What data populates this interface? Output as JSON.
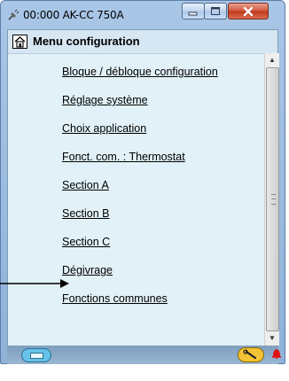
{
  "window": {
    "title": "00:000 AK-CC 750A",
    "icon": "plug-icon",
    "controls": [
      "minimize-icon",
      "maximize-icon",
      "close-icon"
    ]
  },
  "menu": {
    "title": "Menu configuration",
    "home_icon": "home-icon",
    "items": [
      "Bloque / débloque configuration",
      "Réglage système",
      "Choix application",
      "Fonct. com. : Thermostat",
      "Section A",
      "Section B",
      "Section C",
      "Dégivrage",
      "Fonctions communes"
    ]
  },
  "scrollbar": {
    "up": "▲",
    "down": "▼"
  },
  "statusbar": {
    "left_icon": "device-icon",
    "wrench_icon": "wrench-icon",
    "alarm_icon": "alarm-bell-icon"
  },
  "annotation": {
    "arrow_icon": "arrow-right-icon"
  },
  "colors": {
    "client_bg": "#e1f1f7",
    "title_bar": "#a9c6e6",
    "close_button": "#c0381c",
    "alarm": "#e01010"
  }
}
